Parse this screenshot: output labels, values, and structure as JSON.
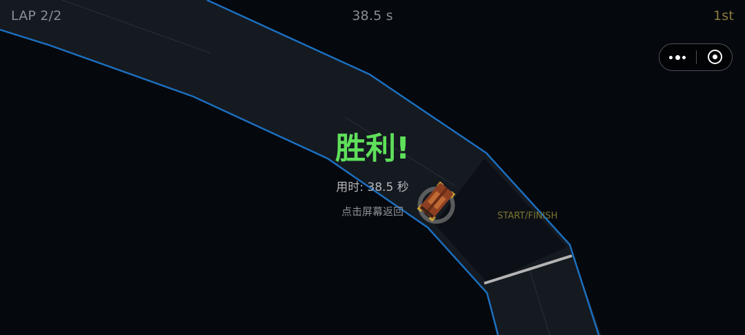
{
  "hud": {
    "lap": "LAP 2/2",
    "time": "38.5 s",
    "position": "1st"
  },
  "result": {
    "title": "胜利!",
    "time_text": "用时: 38.5 秒",
    "hint": "点击屏幕返回"
  },
  "track": {
    "finish_label": "START/FINISH",
    "colors": {
      "background": "#05080d",
      "surface": "#151a21",
      "edge": "#1c6fbf",
      "finish_line": "#b4b4b4",
      "finish_label": "#7b7530",
      "win_text": "#5fe05a"
    }
  },
  "player_car": {
    "icon": "orange-race-car-icon",
    "color": "#a8542a"
  },
  "capsule": {
    "more_icon": "more-dots-icon",
    "close_icon": "close-target-icon"
  }
}
